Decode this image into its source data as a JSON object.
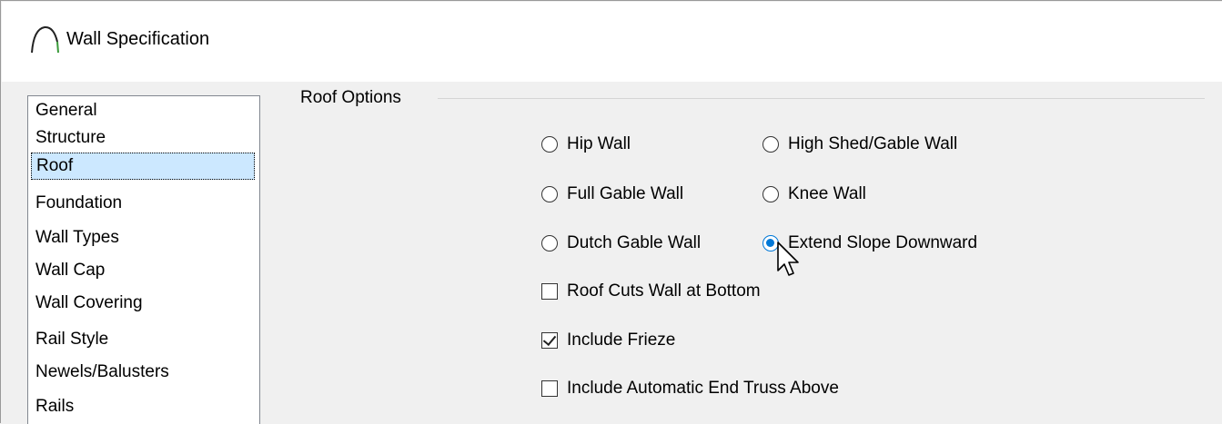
{
  "window": {
    "title": "Wall Specification"
  },
  "sidebar": {
    "items": [
      {
        "label": "General",
        "selected": false
      },
      {
        "label": "Structure",
        "selected": false
      },
      {
        "label": "Roof",
        "selected": true
      },
      {
        "label": "Foundation",
        "selected": false
      },
      {
        "label": "Wall Types",
        "selected": false
      },
      {
        "label": "Wall Cap",
        "selected": false
      },
      {
        "label": "Wall Covering",
        "selected": false
      },
      {
        "label": "Rail Style",
        "selected": false
      },
      {
        "label": "Newels/Balusters",
        "selected": false
      },
      {
        "label": "Rails",
        "selected": false
      }
    ]
  },
  "roof_options": {
    "group_label": "Roof Options",
    "radios": {
      "hip_wall": {
        "label": "Hip Wall",
        "checked": false
      },
      "high_shed_gable_wall": {
        "label": "High Shed/Gable Wall",
        "checked": false
      },
      "full_gable_wall": {
        "label": "Full Gable Wall",
        "checked": false
      },
      "knee_wall": {
        "label": "Knee Wall",
        "checked": false
      },
      "dutch_gable_wall": {
        "label": "Dutch Gable Wall",
        "checked": false
      },
      "extend_slope_downward": {
        "label": "Extend Slope Downward",
        "checked": true
      }
    },
    "checkboxes": {
      "roof_cuts_wall_at_bottom": {
        "label": "Roof Cuts Wall at Bottom",
        "checked": false
      },
      "include_frieze": {
        "label": "Include Frieze",
        "checked": true
      },
      "include_automatic_end_truss_above": {
        "label": "Include Automatic End Truss Above",
        "checked": false
      }
    }
  },
  "colors": {
    "accent": "#0078d7",
    "selection": "#cce8ff"
  }
}
